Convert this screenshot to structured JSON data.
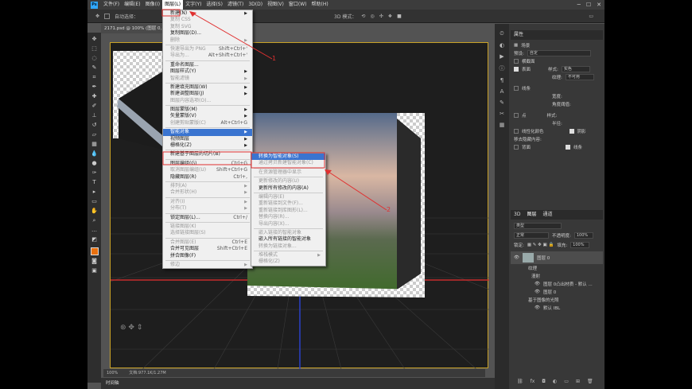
{
  "menubar": {
    "logo": "Ps",
    "items": [
      "文件(F)",
      "编辑(E)",
      "图像(I)",
      "图层(L)",
      "文字(Y)",
      "选择(S)",
      "滤镜(T)",
      "3D(D)",
      "视图(V)",
      "窗口(W)",
      "帮助(H)"
    ],
    "active_index": 3
  },
  "optbar": {
    "auto_select": "自动选择：",
    "mode_3d": "3D 模式："
  },
  "doc_tab": "2171.psd @ 100% (图层 0, RGB/8#) *",
  "status": {
    "zoom": "100%",
    "doc": "文档:977.1K/1.27M"
  },
  "timeline": "时间轴",
  "layer_menu": [
    {
      "label": "新建(N)",
      "arrow": true
    },
    {
      "label": "复制 CSS",
      "dis": true
    },
    {
      "label": "复制 SVG",
      "dis": true
    },
    {
      "label": "复制图层(D)..."
    },
    {
      "label": "删除",
      "arrow": true,
      "dis": true
    },
    {
      "sep": true
    },
    {
      "label": "快速导出为 PNG",
      "sc": "Shift+Ctrl+'",
      "dis": true
    },
    {
      "label": "导出为...",
      "sc": "Alt+Shift+Ctrl+'",
      "dis": true
    },
    {
      "sep": true
    },
    {
      "label": "重命名图层..."
    },
    {
      "label": "图层样式(Y)",
      "arrow": true
    },
    {
      "label": "智能滤镜",
      "arrow": true,
      "dis": true
    },
    {
      "sep": true
    },
    {
      "label": "新建填充图层(W)",
      "arrow": true
    },
    {
      "label": "新建调整图层(J)",
      "arrow": true
    },
    {
      "label": "图层内容选项(O)...",
      "dis": true
    },
    {
      "sep": true
    },
    {
      "label": "图层蒙版(M)",
      "arrow": true
    },
    {
      "label": "矢量蒙版(V)",
      "arrow": true
    },
    {
      "label": "创建剪贴蒙版(C)",
      "sc": "Alt+Ctrl+G",
      "dis": true
    },
    {
      "sep": true
    },
    {
      "label": "智能对象",
      "arrow": true,
      "hl": true
    },
    {
      "label": "视频图层",
      "arrow": true
    },
    {
      "label": "栅格化(Z)",
      "arrow": true
    },
    {
      "sep": true
    },
    {
      "label": "新建基于图层的切片(B)"
    },
    {
      "sep": true
    },
    {
      "label": "图层编组(G)",
      "sc": "Ctrl+G"
    },
    {
      "label": "取消图层编组(U)",
      "sc": "Shift+Ctrl+G",
      "dis": true
    },
    {
      "label": "隐藏图层(R)",
      "sc": "Ctrl+,"
    },
    {
      "sep": true
    },
    {
      "label": "排列(A)",
      "arrow": true,
      "dis": true
    },
    {
      "label": "合并形状(H)",
      "arrow": true,
      "dis": true
    },
    {
      "sep": true
    },
    {
      "label": "对齐(I)",
      "arrow": true,
      "dis": true
    },
    {
      "label": "分布(T)",
      "arrow": true,
      "dis": true
    },
    {
      "sep": true
    },
    {
      "label": "锁定图层(L)...",
      "sc": "Ctrl+/"
    },
    {
      "sep": true
    },
    {
      "label": "链接图层(K)",
      "dis": true
    },
    {
      "label": "选择链接图层(S)",
      "dis": true
    },
    {
      "sep": true
    },
    {
      "label": "合并图层(E)",
      "sc": "Ctrl+E",
      "dis": true
    },
    {
      "label": "合并可见图层",
      "sc": "Shift+Ctrl+E"
    },
    {
      "label": "拼合图像(F)"
    },
    {
      "sep": true
    },
    {
      "label": "修边",
      "arrow": true,
      "dis": true
    }
  ],
  "smart_menu": [
    {
      "label": "转换为智能对象(S)",
      "hl": true
    },
    {
      "label": "通过拷贝新建智能对象(C)",
      "dis": true
    },
    {
      "sep": true
    },
    {
      "label": "在资源管理器中显示",
      "dis": true
    },
    {
      "sep": true
    },
    {
      "label": "更新修改的内容(U)",
      "dis": true
    },
    {
      "label": "更新所有修改的内容(A)"
    },
    {
      "sep": true
    },
    {
      "label": "编辑内容(E)",
      "dis": true
    },
    {
      "label": "重新链接到文件(F)...",
      "dis": true
    },
    {
      "label": "重新链接到库图形(L)...",
      "dis": true
    },
    {
      "label": "替换内容(R)...",
      "dis": true
    },
    {
      "label": "导出内容(X)...",
      "dis": true
    },
    {
      "sep": true
    },
    {
      "label": "嵌入链接的智能对象",
      "dis": true
    },
    {
      "label": "嵌入所有链接的智能对象"
    },
    {
      "label": "转换为链接对象...",
      "dis": true
    },
    {
      "sep": true
    },
    {
      "label": "堆栈模式",
      "arrow": true,
      "dis": true
    },
    {
      "label": "栅格化(Z)",
      "dis": true
    }
  ],
  "annotations": {
    "one": "1",
    "two": "2"
  },
  "props": {
    "title": "属性",
    "scene": "场景",
    "preset_label": "预设:",
    "preset_value": "自定",
    "cross_section": "横截面",
    "surface": "表面",
    "style_label": "样式:",
    "style_value": "实色",
    "texture_label": "纹理:",
    "texture_value": "不可用",
    "lines": "线条",
    "points": "点",
    "width": "宽度:",
    "angle": "角度阈值:",
    "style2": "样式:",
    "radius": "半径:",
    "linearize": "线性化颜色",
    "shadows": "阴影",
    "remove_hidden": "移去隐藏内容:",
    "backface": "背面",
    "lines2": "线条"
  },
  "layers": {
    "tabs": [
      "3D",
      "图层",
      "通道"
    ],
    "kind": "类型",
    "blend": "正常",
    "opacity_label": "不透明度:",
    "opacity": "100%",
    "lock_label": "锁定:",
    "fill_label": "填充:",
    "fill": "100%",
    "layer_name": "图层 0",
    "effects": "纹理",
    "diffuse": "漫射",
    "texture1": "图层 0凸出材质 - 默认 ...",
    "texture2": "图层 0",
    "scene_light": "基于图像的光照",
    "default_ibl": "默认 IBL"
  }
}
